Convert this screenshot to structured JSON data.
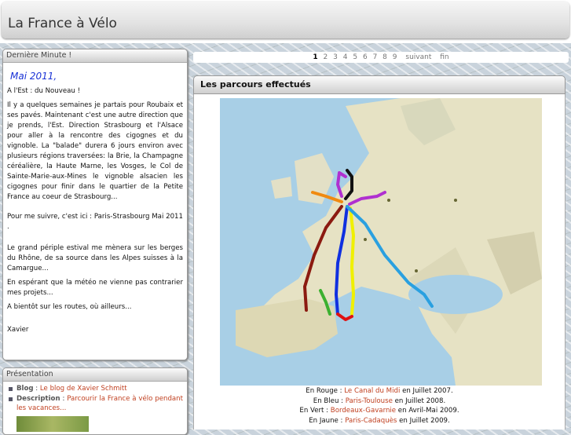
{
  "header": {
    "site_title": "La France à Vélo"
  },
  "news": {
    "title": "Dernière Minute !",
    "date": "Mai 2011,",
    "paragraphs": [
      "A l'Est : du Nouveau !",
      "Il y a quelques semaines je partais pour Roubaix et ses pavés. Maintenant c'est une autre direction que je prends, l'Est. Direction Strasbourg et l'Alsace pour aller à la rencontre des cigognes et du vignoble. La \"balade\" durera 6 jours environ avec plusieurs régions traversées: la Brie, la Champagne céréalière, la Haute Marne, les Vosges, le Col de Sainte-Marie-aux-Mines le vignoble alsacien les cigognes pour finir dans le quartier de la Petite France au coeur de Strasbourg...",
      "Pour me suivre, c'est ici : Paris-Strasbourg Mai 2011 .",
      "Le grand périple estival me mènera sur les berges du Rhône, de sa source dans les Alpes suisses à la Camargue...",
      "En espérant que la météo ne vienne pas contrarier mes projets...",
      "A bientôt sur les routes, où ailleurs...",
      "Xavier"
    ]
  },
  "pager": {
    "pages": [
      "1",
      "2",
      "3",
      "4",
      "5",
      "6",
      "7",
      "8",
      "9"
    ],
    "current": "1",
    "next": "suivant",
    "last": "fin"
  },
  "main": {
    "title": "Les parcours effectués",
    "legend": [
      {
        "prefix": "En Rouge : ",
        "link": "Le Canal du Midi",
        "suffix": " en Juillet 2007."
      },
      {
        "prefix": "En Bleu : ",
        "link": "Paris-Toulouse",
        "suffix": " en Juillet 2008."
      },
      {
        "prefix": "En Vert : ",
        "link": "Bordeaux-Gavarnie",
        "suffix": " en Avril-Mai 2009."
      },
      {
        "prefix": "En Jaune : ",
        "link": "Paris-Cadaquès",
        "suffix": " en Juillet 2009."
      }
    ]
  },
  "presentation": {
    "title": "Présentation",
    "items": [
      {
        "label": "Blog",
        "sep": " : ",
        "text": "Le blog de Xavier Schmitt"
      },
      {
        "label": "Description",
        "sep": " : ",
        "text": "Parcourir la France à vélo pendant les vacances..."
      }
    ]
  },
  "colors": {
    "route_red": "#8b1a10",
    "route_blue": "#1030e0",
    "route_green": "#3cb030",
    "route_yellow": "#f0f000",
    "route_purple": "#b030d0",
    "route_black": "#111111",
    "route_cyan": "#2aa0e0",
    "route_orange": "#f08a10",
    "link": "#c04020",
    "date": "#1a33d6"
  }
}
